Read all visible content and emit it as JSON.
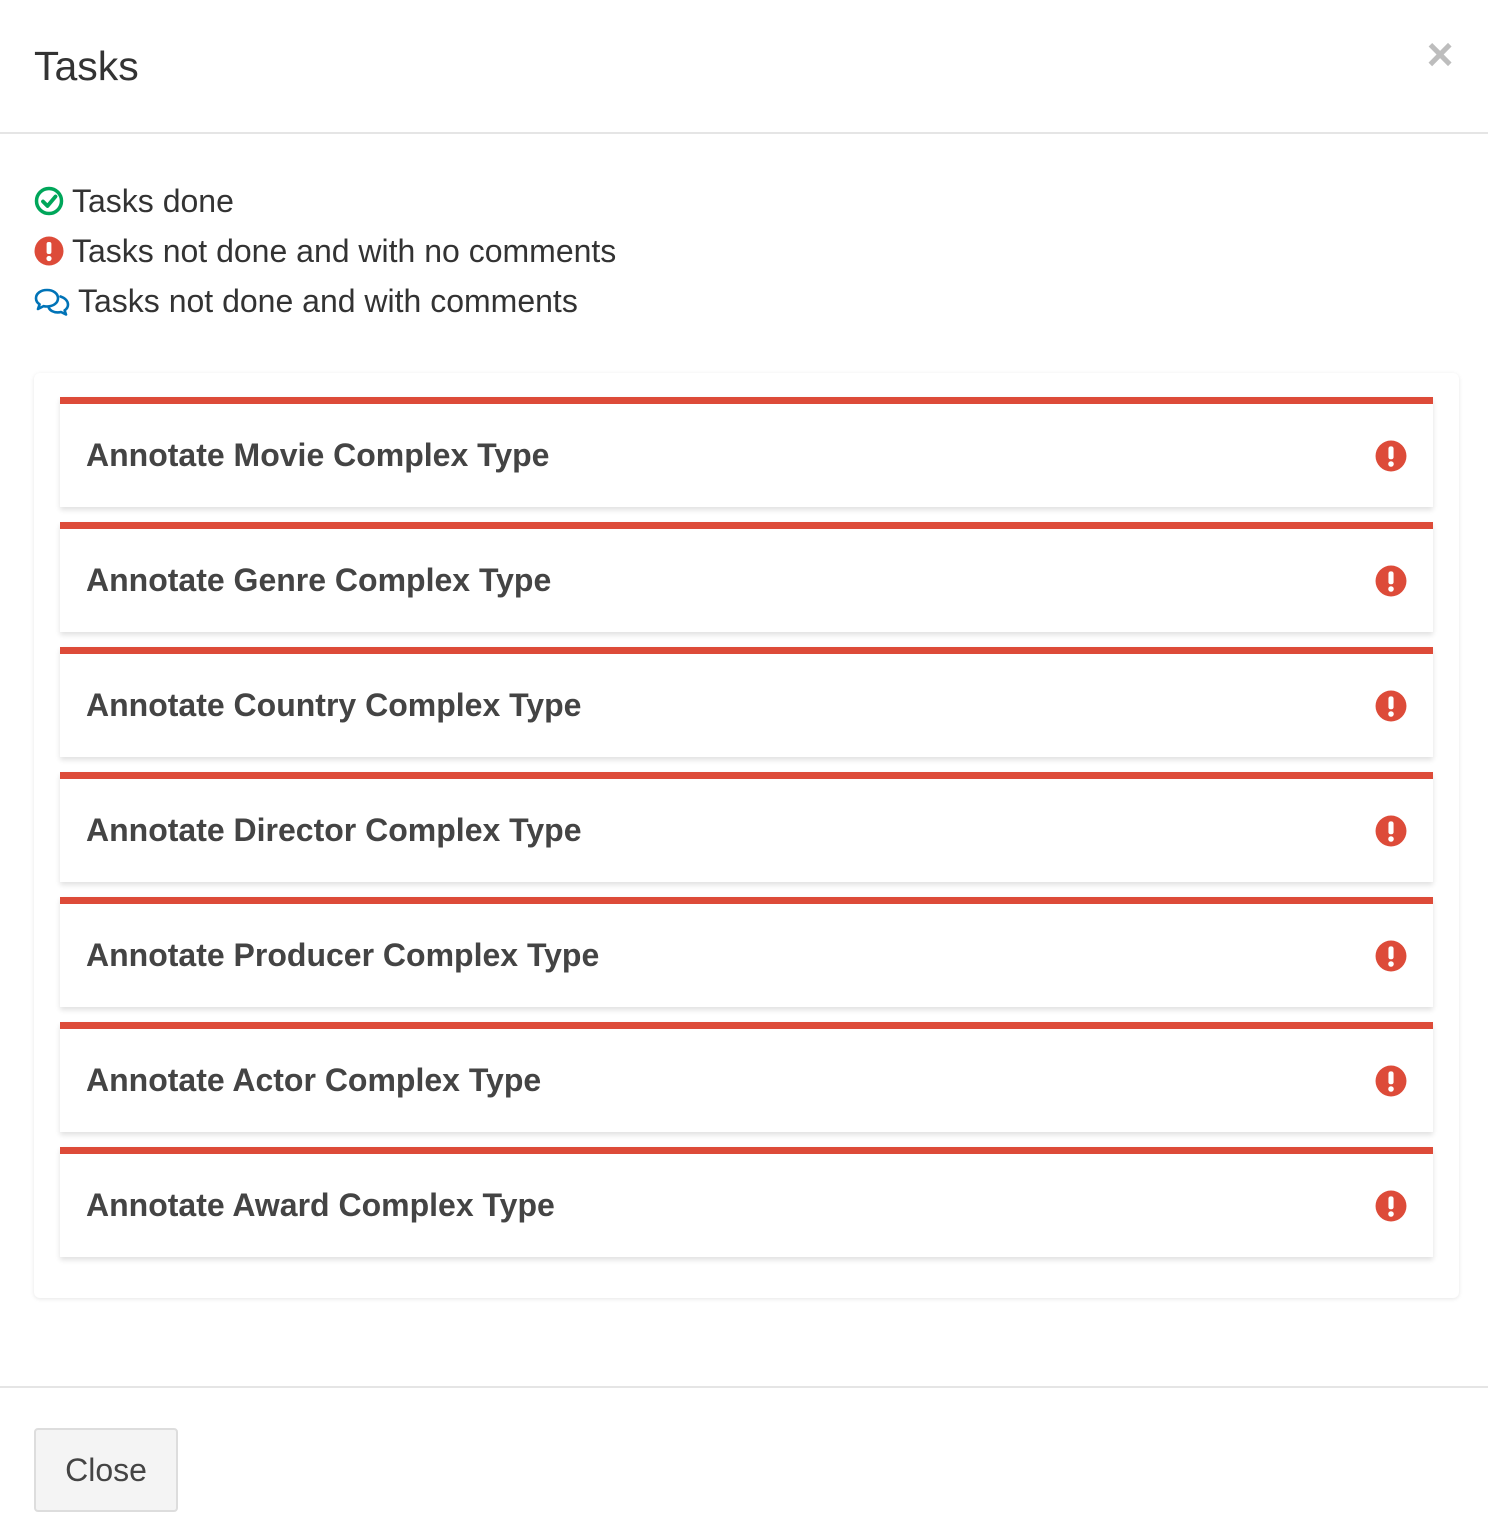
{
  "modal": {
    "title": "Tasks",
    "close_symbol": "×"
  },
  "legend": [
    {
      "icon": "check-circle-icon",
      "color": "#00a65a",
      "label": "Tasks done"
    },
    {
      "icon": "exclamation-circle-icon",
      "color": "#dd4b39",
      "label": "Tasks not done and with no comments"
    },
    {
      "icon": "comments-icon",
      "color": "#0073b7",
      "label": "Tasks not done and with comments"
    }
  ],
  "tasks": [
    {
      "label": "Annotate Movie Complex Type",
      "status_icon": "exclamation-circle-icon"
    },
    {
      "label": "Annotate Genre Complex Type",
      "status_icon": "exclamation-circle-icon"
    },
    {
      "label": "Annotate Country Complex Type",
      "status_icon": "exclamation-circle-icon"
    },
    {
      "label": "Annotate Director Complex Type",
      "status_icon": "exclamation-circle-icon"
    },
    {
      "label": "Annotate Producer Complex Type",
      "status_icon": "exclamation-circle-icon"
    },
    {
      "label": "Annotate Actor Complex Type",
      "status_icon": "exclamation-circle-icon"
    },
    {
      "label": "Annotate Award Complex Type",
      "status_icon": "exclamation-circle-icon"
    }
  ],
  "colors": {
    "task_accent": "#dd4b39",
    "done": "#00a65a",
    "comments": "#0073b7"
  },
  "footer": {
    "close_label": "Close"
  }
}
